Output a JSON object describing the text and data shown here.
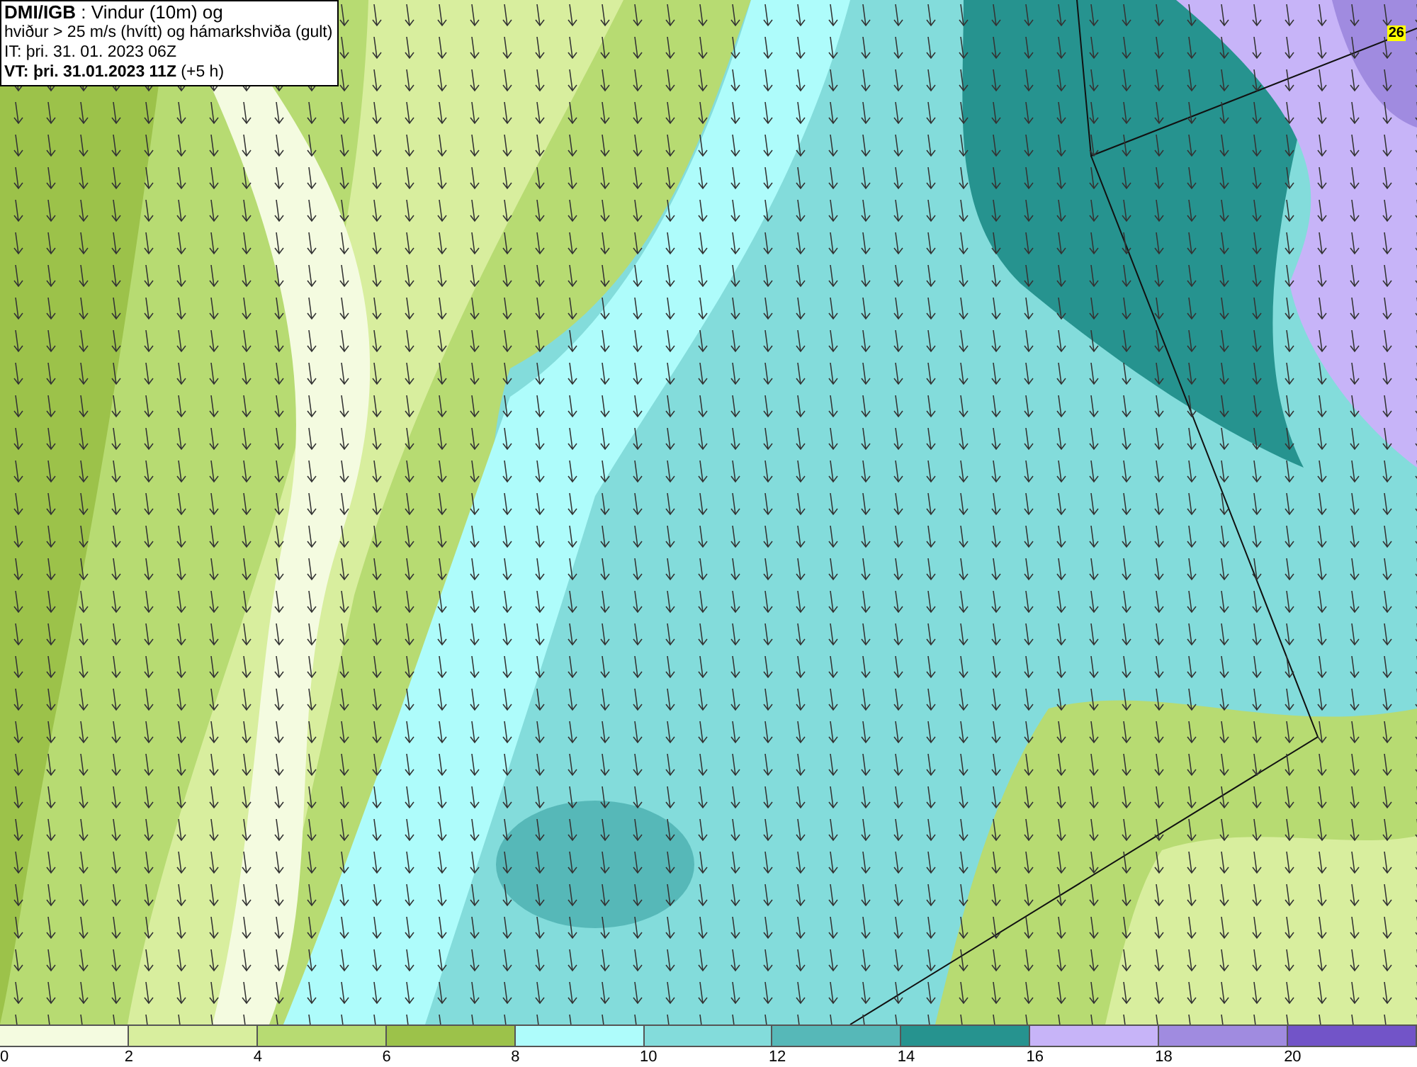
{
  "info": {
    "lines": [
      "**DMI/IGB** : Vindur (10m) og",
      "hviður > 25 m/s (hvítt) og hámarkshviða (gult)",
      "IT: þri. 31. 01. 2023 06Z",
      "**VT: þri. 31.01.2023 11Z** (+5 h)"
    ]
  },
  "map": {
    "gust_max": "26"
  },
  "legend": [
    {
      "label": "0",
      "color": "#f4fbe0"
    },
    {
      "label": "2",
      "color": "#d8ee9e"
    },
    {
      "label": "4",
      "color": "#b7db72"
    },
    {
      "label": "6",
      "color": "#9cc24a"
    },
    {
      "label": "8",
      "color": "#aefcfb"
    },
    {
      "label": "10",
      "color": "#83dcdb"
    },
    {
      "label": "12",
      "color": "#56b8b8"
    },
    {
      "label": "14",
      "color": "#26938f"
    },
    {
      "label": "16",
      "color": "#c7b4f8"
    },
    {
      "label": "18",
      "color": "#a08be0"
    },
    {
      "label": "20",
      "color": "#7254c8"
    }
  ]
}
